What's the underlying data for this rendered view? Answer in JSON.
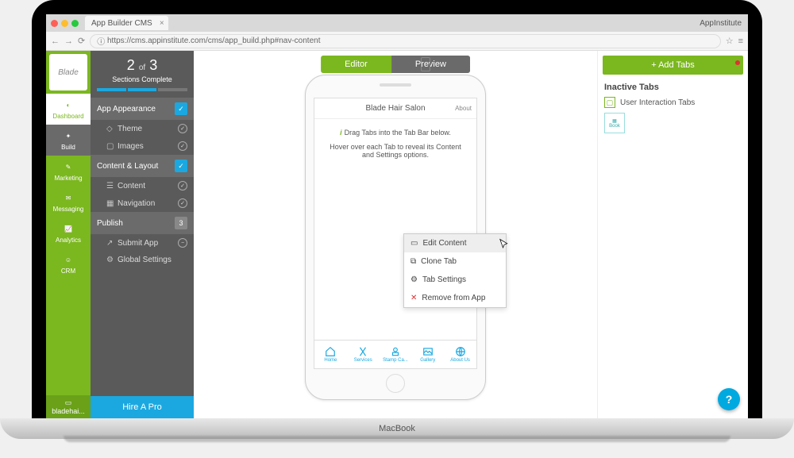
{
  "browser": {
    "tab_title": "App Builder CMS",
    "brand": "AppInstitute",
    "url": "https://cms.appinstitute.com/cms/app_build.php#nav-content"
  },
  "rail": {
    "logo_text": "Blade",
    "items": [
      {
        "label": "Dashboard"
      },
      {
        "label": "Build"
      },
      {
        "label": "Marketing"
      },
      {
        "label": "Messaging"
      },
      {
        "label": "Analytics"
      },
      {
        "label": "CRM"
      }
    ],
    "footer": "bladehai..."
  },
  "progress": {
    "current": "2",
    "total": "3",
    "of": "of",
    "label": "Sections Complete"
  },
  "sections": {
    "appearance": {
      "title": "App Appearance",
      "items": [
        "Theme",
        "Images"
      ]
    },
    "content": {
      "title": "Content & Layout",
      "items": [
        "Content",
        "Navigation"
      ]
    },
    "publish": {
      "title": "Publish",
      "badge": "3",
      "items": [
        "Submit App",
        "Global Settings"
      ]
    }
  },
  "hire": "Hire A Pro",
  "mode": {
    "editor": "Editor",
    "preview": "Preview"
  },
  "phone": {
    "title": "Blade Hair Salon",
    "about": "About",
    "hint1": "Drag Tabs into the Tab Bar below.",
    "hint2": "Hover over each Tab to reveal its Content and Settings options.",
    "tabs": [
      "Home",
      "Services",
      "Stamp Ca...",
      "Gallery",
      "About Us"
    ]
  },
  "ctx": {
    "edit": "Edit Content",
    "clone": "Clone Tab",
    "settings": "Tab Settings",
    "remove": "Remove from App"
  },
  "right": {
    "add": "+ Add Tabs",
    "inactive_h": "Inactive Tabs",
    "row": "User Interaction Tabs",
    "book": "Book"
  },
  "laptop": "MacBook"
}
